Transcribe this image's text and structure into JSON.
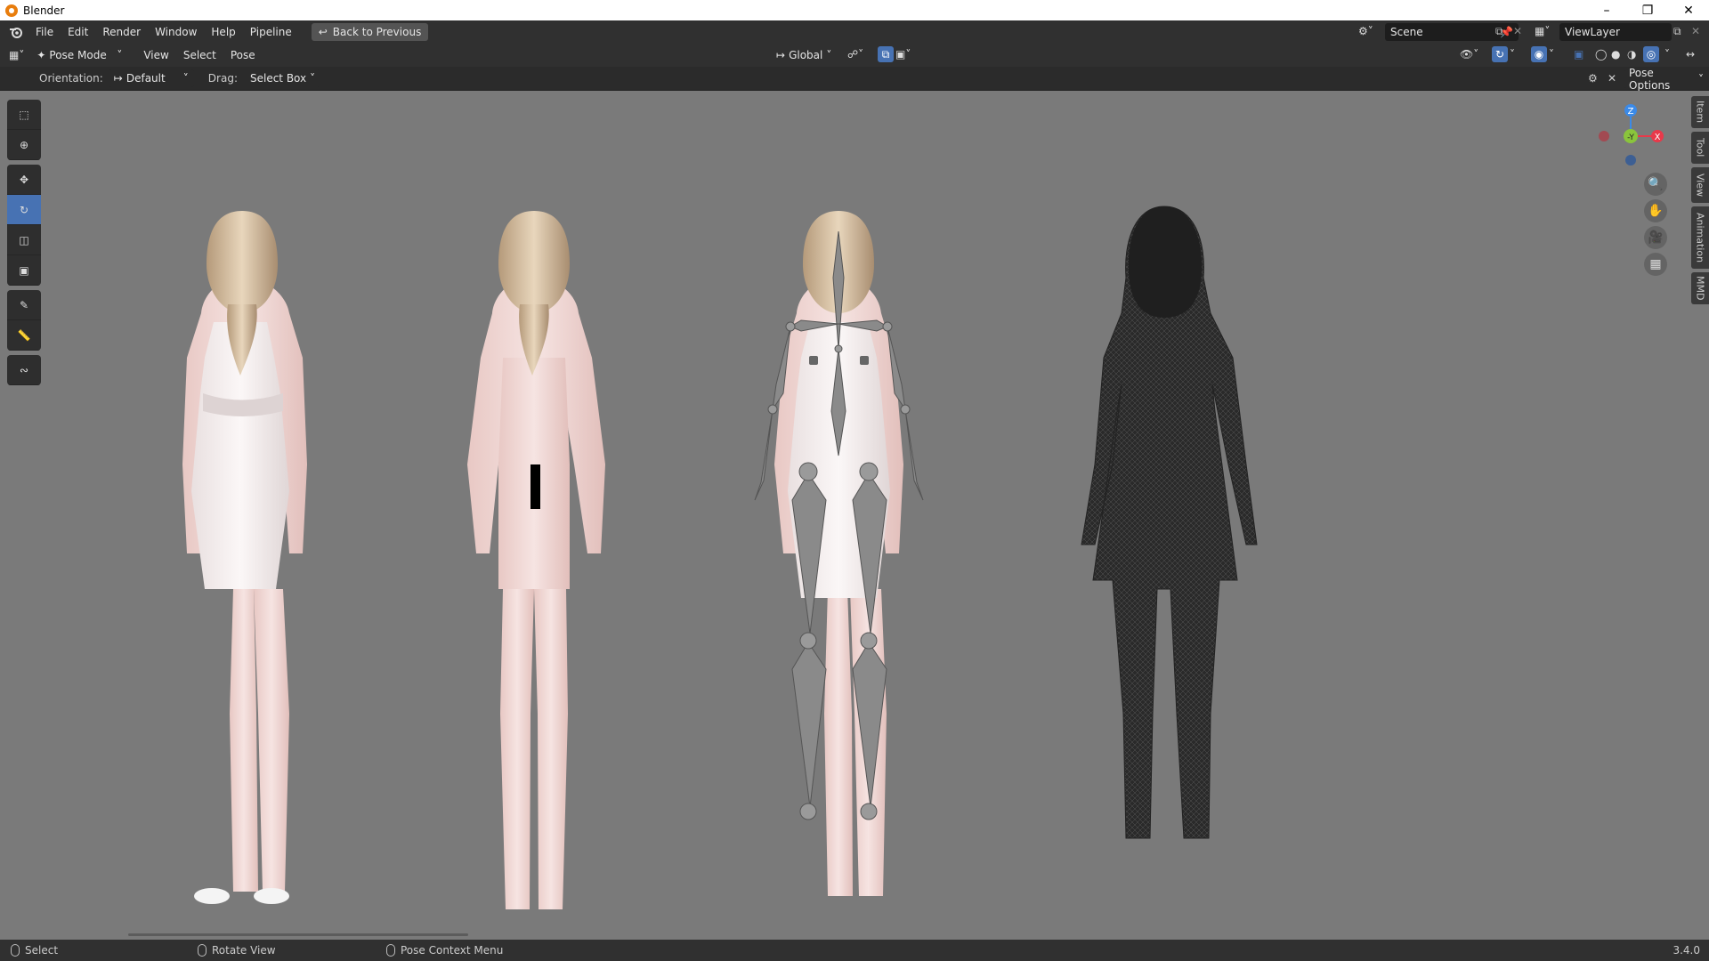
{
  "window": {
    "title": "Blender"
  },
  "menubar": {
    "items": [
      "File",
      "Edit",
      "Render",
      "Window",
      "Help",
      "Pipeline"
    ],
    "back_button": "Back to Previous",
    "scene": "Scene",
    "view_layer": "ViewLayer"
  },
  "header": {
    "mode": "Pose Mode",
    "menus": [
      "View",
      "Select",
      "Pose"
    ],
    "transform_orientation": "Global"
  },
  "tool_header": {
    "orientation_label": "Orientation:",
    "orientation_value": "Default",
    "drag_label": "Drag:",
    "drag_value": "Select Box",
    "pose_options": "Pose Options"
  },
  "gizmo": {
    "z": "Z",
    "y": "-Y",
    "x": "X"
  },
  "sidebar_tabs": [
    "Item",
    "Tool",
    "View",
    "Animation",
    "MMD"
  ],
  "status": {
    "select": "Select",
    "rotate": "Rotate View",
    "context": "Pose Context Menu",
    "version": "3.4.0"
  },
  "colors": {
    "accent": "#4772b3",
    "viewport_bg": "#7a7a7a",
    "x_axis": "#e8394a",
    "y_axis": "#8ac43c",
    "z_axis": "#3b8ae8"
  }
}
